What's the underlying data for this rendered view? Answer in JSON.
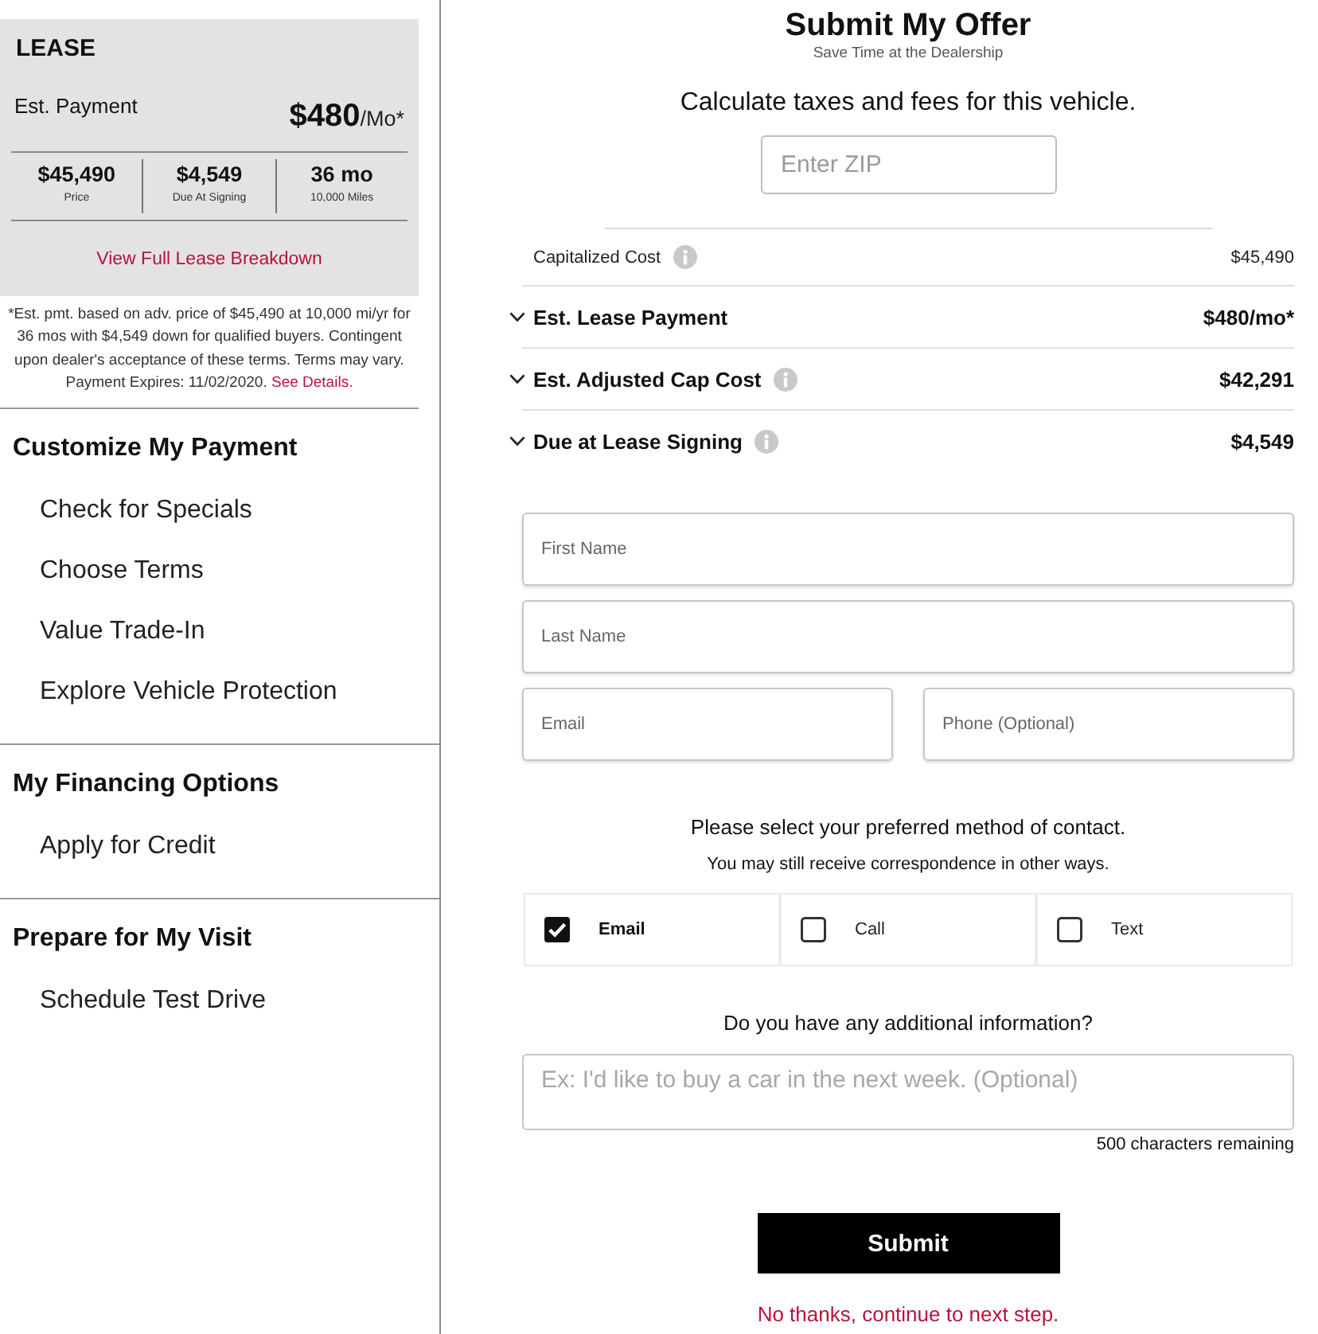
{
  "lease_card": {
    "title": "LEASE",
    "payment_label": "Est. Payment",
    "payment_amount": "$480",
    "payment_unit": "/Mo*",
    "stats": [
      {
        "value": "$45,490",
        "label": "Price"
      },
      {
        "value": "$4,549",
        "label": "Due At Signing"
      },
      {
        "value": "36 mo",
        "label": "10,000 Miles"
      }
    ],
    "breakdown_link": "View Full Lease Breakdown"
  },
  "disclaimer": {
    "text": "*Est. pmt. based on adv. price of $45,490 at 10,000 mi/yr for 36 mos with $4,549 down for qualified buyers. Contingent upon dealer's acceptance of these terms. Terms may vary. Payment Expires: 11/02/2020.",
    "link": "See Details."
  },
  "sidebar": {
    "sections": [
      {
        "heading": "Customize My Payment",
        "items": [
          "Check for Specials",
          "Choose Terms",
          "Value Trade-In",
          "Explore Vehicle Protection"
        ]
      },
      {
        "heading": "My Financing Options",
        "items": [
          "Apply for Credit"
        ]
      },
      {
        "heading": "Prepare for My Visit",
        "items": [
          "Schedule Test Drive"
        ]
      }
    ]
  },
  "offer": {
    "title": "Submit My Offer",
    "subtitle": "Save Time at the Dealership",
    "zip_prompt": "Calculate taxes and fees for this vehicle.",
    "zip_field": {
      "placeholder": "Enter ZIP"
    }
  },
  "cost_rows": [
    {
      "kind": "plain",
      "label": "Capitalized Cost",
      "info": true,
      "value": "$45,490"
    },
    {
      "kind": "expandable",
      "label": "Est. Lease Payment",
      "info": false,
      "value": "$480/mo*",
      "expanded": false
    },
    {
      "kind": "expandable",
      "label": "Est. Adjusted Cap Cost",
      "info": true,
      "value": "$42,291",
      "expanded": false
    },
    {
      "kind": "expandable",
      "label": "Due at Lease Signing",
      "info": true,
      "value": "$4,549",
      "expanded": false
    }
  ],
  "form": {
    "field_rows": [
      [
        {
          "placeholder": "First Name"
        }
      ],
      [
        {
          "placeholder": "Last Name"
        }
      ],
      [
        {
          "placeholder": "Email"
        },
        {
          "placeholder": "Phone (Optional)"
        }
      ]
    ]
  },
  "contact": {
    "prompt": "Please select your preferred method of contact.",
    "note": "You may still receive correspondence in other ways.",
    "options": [
      {
        "label": "Email",
        "checked": true
      },
      {
        "label": "Call",
        "checked": false
      },
      {
        "label": "Text",
        "checked": false
      }
    ]
  },
  "additional": {
    "prompt": "Do you have any additional information?",
    "field": {
      "placeholder": "Ex: I'd like to buy a car in the next week. (Optional)"
    },
    "counter": "500 characters remaining"
  },
  "submit_button": "Submit",
  "skip_link": "No thanks, continue to next step."
}
